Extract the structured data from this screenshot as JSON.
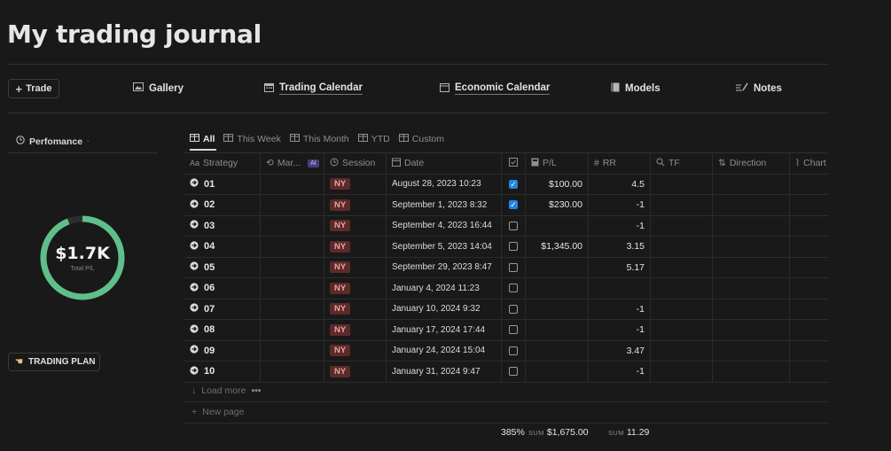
{
  "page": {
    "title": "My trading journal"
  },
  "nav": {
    "trade_button": "Trade",
    "links": [
      {
        "label": "Gallery",
        "icon": "image-icon"
      },
      {
        "label": "Trading Calendar",
        "icon": "calendar-icon"
      },
      {
        "label": "Economic Calendar",
        "icon": "window-icon"
      },
      {
        "label": "Models",
        "icon": "book-icon"
      },
      {
        "label": "Notes",
        "icon": "pencil-lines-icon"
      }
    ]
  },
  "sidebar": {
    "performance_label": "Perfomance",
    "total_value": "$1.7K",
    "total_label": "Total P/L",
    "trading_plan_button": "TRADING PLAN",
    "donut_fill_fraction": 0.94
  },
  "views": {
    "tabs": [
      "All",
      "This Week",
      "This Month",
      "YTD",
      "Custom"
    ],
    "active": "All"
  },
  "table": {
    "columns": [
      "Strategy",
      "Mar...",
      "Session",
      "Date",
      "",
      "P/L",
      "RR",
      "TF",
      "Direction",
      "Chart"
    ],
    "ai_badge": "AI",
    "rows": [
      {
        "strategy": "01",
        "session": "NY",
        "date": "August 28, 2023 10:23",
        "checked": true,
        "pl": "$100.00",
        "rr": "4.5"
      },
      {
        "strategy": "02",
        "session": "NY",
        "date": "September 1, 2023 8:32",
        "checked": true,
        "pl": "$230.00",
        "rr": "-1"
      },
      {
        "strategy": "03",
        "session": "NY",
        "date": "September 4, 2023 16:44",
        "checked": false,
        "pl": "",
        "rr": "-1"
      },
      {
        "strategy": "04",
        "session": "NY",
        "date": "September 5, 2023 14:04",
        "checked": false,
        "pl": "$1,345.00",
        "rr": "3.15"
      },
      {
        "strategy": "05",
        "session": "NY",
        "date": "September 29, 2023 8:47",
        "checked": false,
        "pl": "",
        "rr": "5.17"
      },
      {
        "strategy": "06",
        "session": "NY",
        "date": "January 4, 2024 11:23",
        "checked": false,
        "pl": "",
        "rr": ""
      },
      {
        "strategy": "07",
        "session": "NY",
        "date": "January 10, 2024 9:32",
        "checked": false,
        "pl": "",
        "rr": "-1"
      },
      {
        "strategy": "08",
        "session": "NY",
        "date": "January 17, 2024 17:44",
        "checked": false,
        "pl": "",
        "rr": "-1"
      },
      {
        "strategy": "09",
        "session": "NY",
        "date": "January 24, 2024 15:04",
        "checked": false,
        "pl": "",
        "rr": "3.47"
      },
      {
        "strategy": "10",
        "session": "NY",
        "date": "January 31, 2024 9:47",
        "checked": false,
        "pl": "",
        "rr": "-1"
      }
    ],
    "load_more": "Load more",
    "new_page": "New page",
    "footer": {
      "checked_percent": "385%",
      "sum_label": "SUM",
      "pl_sum": "$1,675.00",
      "rr_sum": "11.29"
    }
  },
  "colors": {
    "background": "#191919",
    "donut_green": "#5fbf8a",
    "tag_bg": "#5c2b29",
    "checkbox_blue": "#2383e2"
  }
}
